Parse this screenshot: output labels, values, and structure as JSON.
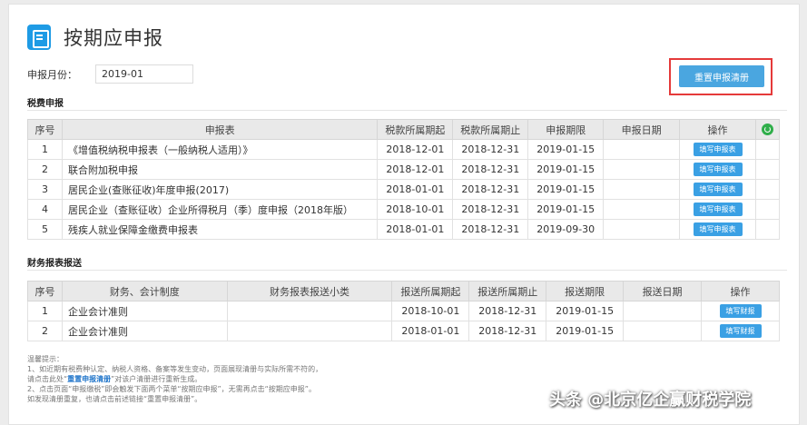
{
  "header": {
    "title": "按期应申报"
  },
  "month": {
    "label": "申报月份：",
    "value": "2019-01"
  },
  "reset_button_label": "重置申报清册",
  "tax": {
    "section_title": "税费申报",
    "columns": [
      "序号",
      "申报表",
      "税款所属期起",
      "税款所属期止",
      "申报期限",
      "申报日期",
      "操作"
    ],
    "rows": [
      {
        "no": "1",
        "form": "《增值税纳税申报表（一般纳税人适用）》",
        "start": "2018-12-01",
        "end": "2018-12-31",
        "deadline": "2019-01-15",
        "date": "",
        "action": "填写申报表"
      },
      {
        "no": "2",
        "form": "联合附加税申报",
        "start": "2018-12-01",
        "end": "2018-12-31",
        "deadline": "2019-01-15",
        "date": "",
        "action": "填写申报表"
      },
      {
        "no": "3",
        "form": "居民企业(查账征收)年度申报(2017)",
        "start": "2018-01-01",
        "end": "2018-12-31",
        "deadline": "2019-01-15",
        "date": "",
        "action": "填写申报表"
      },
      {
        "no": "4",
        "form": "居民企业（查账征收）企业所得税月（季）度申报（2018年版）",
        "start": "2018-10-01",
        "end": "2018-12-31",
        "deadline": "2019-01-15",
        "date": "",
        "action": "填写申报表"
      },
      {
        "no": "5",
        "form": "残疾人就业保障金缴费申报表",
        "start": "2018-01-01",
        "end": "2018-12-31",
        "deadline": "2019-09-30",
        "date": "",
        "action": "填写申报表"
      }
    ]
  },
  "finance": {
    "section_title": "财务报表报送",
    "columns": [
      "序号",
      "财务、会计制度",
      "财务报表报送小类",
      "报送所属期起",
      "报送所属期止",
      "报送期限",
      "报送日期",
      "操作"
    ],
    "rows": [
      {
        "no": "1",
        "system": "企业会计准则",
        "subtype": "",
        "start": "2018-10-01",
        "end": "2018-12-31",
        "deadline": "2019-01-15",
        "date": "",
        "action": "填写财报"
      },
      {
        "no": "2",
        "system": "企业会计准则",
        "subtype": "",
        "start": "2018-01-01",
        "end": "2018-12-31",
        "deadline": "2019-01-15",
        "date": "",
        "action": "填写财报"
      }
    ]
  },
  "notes": {
    "title": "温馨提示：",
    "line1": "1、如近期有税费种认定、纳税人资格、备案等发生变动，页面展现清册与实际所需不符的，",
    "line2a": "请点击此处“",
    "line2_link": "重置申报清册",
    "line2b": "”对该户清册进行重新生成。",
    "line3": "2、点击页面“申报缴税”即会触发下面两个菜单“按期应申报”，无需再点击“按期应申报”。",
    "line4": "如发现清册重复，也请点击前述链接“重置申报清册”。"
  },
  "watermark": "头条 @北京亿企赢财税学院"
}
